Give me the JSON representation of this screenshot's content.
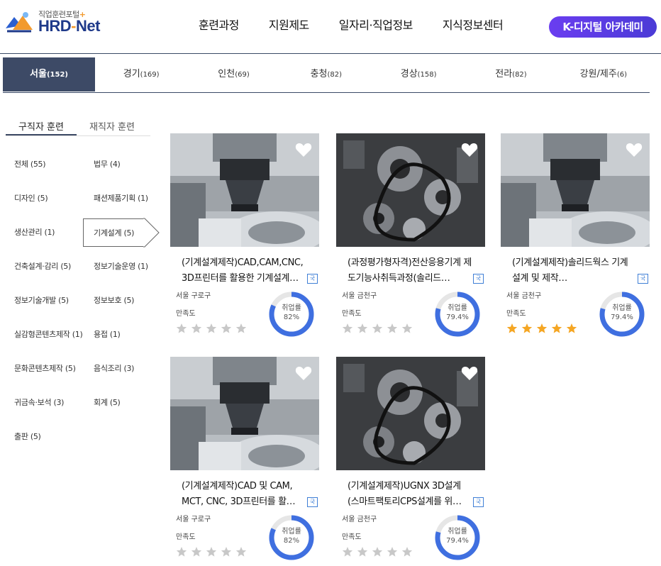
{
  "header": {
    "logo_sub": "직업훈련포털",
    "logo_plus": "+",
    "logo_main_a": "HRD",
    "logo_main_b": "-",
    "logo_main_c": "Net",
    "nav": [
      "훈련과정",
      "지원제도",
      "일자리·직업정보",
      "지식정보센터"
    ],
    "cta": "K-디지털 아카데미"
  },
  "regions": [
    {
      "label": "서울",
      "count": "(152)",
      "active": true
    },
    {
      "label": "경기",
      "count": "(169)"
    },
    {
      "label": "인천",
      "count": "(69)"
    },
    {
      "label": "충청",
      "count": "(82)"
    },
    {
      "label": "경상",
      "count": "(158)"
    },
    {
      "label": "전라",
      "count": "(82)"
    },
    {
      "label": "강원/제주",
      "count": "(6)"
    }
  ],
  "sidebar": {
    "tabs": [
      "구직자 훈련",
      "재직자 훈련"
    ],
    "categories": [
      "전체 (55)",
      "법무 (4)",
      "디자인 (5)",
      "패션제품기획 (1)",
      "생산관리 (1)",
      "기계설계 (5)",
      "건축설계·감리 (5)",
      "정보기술운영 (1)",
      "정보기술개발 (5)",
      "정보보호 (5)",
      "실감형콘텐츠제작 (1)",
      "용접 (1)",
      "문화콘텐츠제작 (5)",
      "음식조리 (3)",
      "귀금속·보석 (3)",
      "회계 (5)",
      "출판 (5)"
    ],
    "selected": "기계설계 (5)"
  },
  "common": {
    "badge": "국",
    "sat_label": "만족도",
    "emp_label": "취업률"
  },
  "colors": {
    "donut": "#3f6fe0",
    "donut_track": "#e6e6e6",
    "star_on": "#f5a623",
    "star_off": "#c8c8c8",
    "region_active": "#3d4a66"
  },
  "cards": [
    {
      "title": "(기계설계제작)CAD,CAM,CNC, 3D프린터를 활용한 기계설계…",
      "location": "서울 구로구",
      "rate": "82%",
      "rate_value": 82,
      "stars": 0,
      "image": "cnc-milling"
    },
    {
      "title": "(과정평가형자격)전산응용기계 제도기능사취득과정(솔리드…",
      "location": "서울 금천구",
      "rate": "79.4%",
      "rate_value": 79.4,
      "stars": 0,
      "image": "engine"
    },
    {
      "title": "(기계설계제작)솔리드웍스 기계 설계 및 제작…",
      "location": "서울 금천구",
      "rate": "79.4%",
      "rate_value": 79.4,
      "stars": 5,
      "image": "cnc-milling"
    },
    {
      "title": "(기계설계제작)CAD 및 CAM, MCT, CNC, 3D프린터를 활…",
      "location": "서울 구로구",
      "rate": "82%",
      "rate_value": 82,
      "stars": 0,
      "image": "cnc-milling"
    },
    {
      "title": "(기계설계제작)UGNX 3D설계 (스마트팩토리CPS설계를 위…",
      "location": "서울 금천구",
      "rate": "79.4%",
      "rate_value": 79.4,
      "stars": 0,
      "image": "engine"
    }
  ]
}
